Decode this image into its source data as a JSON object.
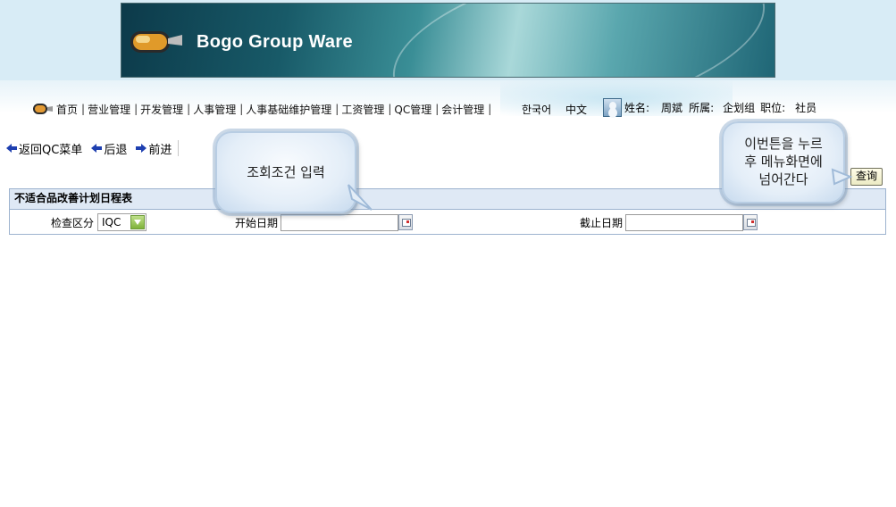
{
  "banner": {
    "title": "Bogo Group Ware"
  },
  "nav": {
    "items": [
      "首页",
      "营业管理",
      "开发管理",
      "人事管理",
      "人事基础维护管理",
      "工资管理",
      "QC管理",
      "会计管理"
    ],
    "separator": "|",
    "languages": [
      "한국어",
      "中文"
    ]
  },
  "user": {
    "name_label": "姓名:",
    "name": "周斌",
    "dept_label": "所属:",
    "dept": "企划组",
    "position_label": "职位:",
    "position": "社员"
  },
  "subnav": {
    "back_to_menu": "返回QC菜单",
    "back": "后退",
    "forward": "前进"
  },
  "panel": {
    "title": "不适合品改善计划日程表",
    "check_type_label": "检查区分",
    "check_type_value": "IQC",
    "start_date_label": "开始日期",
    "start_date_value": "",
    "end_date_label": "截止日期",
    "end_date_value": ""
  },
  "query_button": "查询",
  "callouts": {
    "input": "조회조건 입력",
    "menu_line1": "이번튼을 누르",
    "menu_line2": "후 메뉴화면에",
    "menu_line3": "넘어간다"
  }
}
